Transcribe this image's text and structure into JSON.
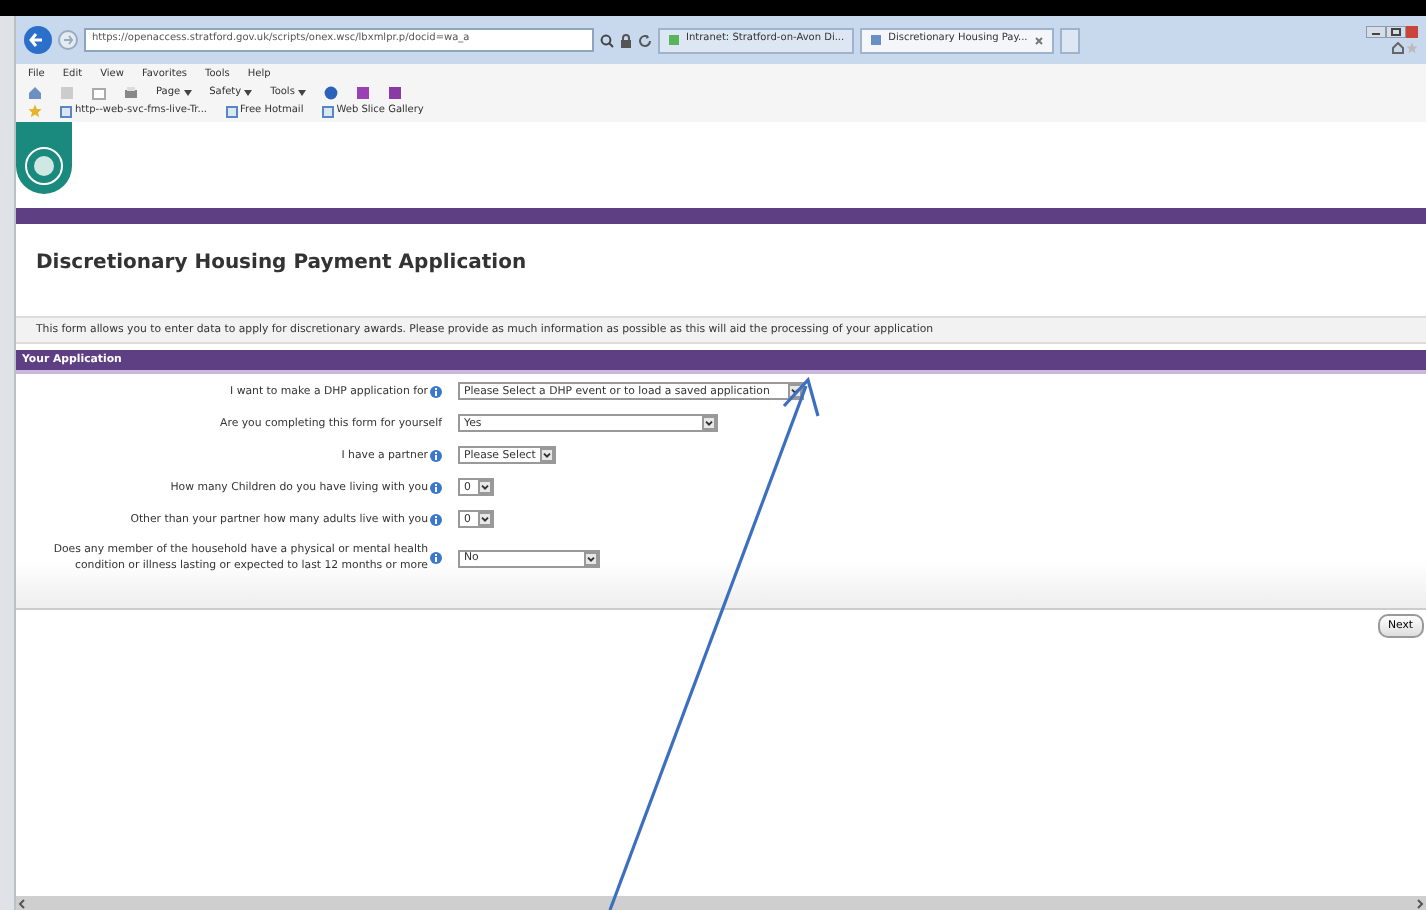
{
  "browser": {
    "address": "https://openaccess.stratford.gov.uk/scripts/onex.wsc/lbxmlpr.p/docid=wa_a",
    "tabs": [
      {
        "label": "Intranet: Stratford-on-Avon Di...",
        "selected": false
      },
      {
        "label": "Discretionary Housing Pay...",
        "selected": true
      }
    ],
    "menu": [
      "File",
      "Edit",
      "View",
      "Favorites",
      "Tools",
      "Help"
    ],
    "commands": [
      "Page",
      "Safety",
      "Tools"
    ],
    "favorites": [
      "http--web-svc-fms-live-Tr...",
      "Free Hotmail",
      "Web Slice Gallery"
    ]
  },
  "page": {
    "title": "Discretionary Housing Payment Application",
    "intro": "This form allows you to enter data to apply for discretionary awards. Please provide as much information as possible as this will aid the processing of your application",
    "section": "Your Application",
    "fields": [
      {
        "label": "I want to make a DHP application for",
        "help": true,
        "value": "Please Select a DHP event or to load a saved application"
      },
      {
        "label": "Are you completing this form for yourself",
        "help": false,
        "value": "Yes"
      },
      {
        "label": "I have a partner",
        "help": true,
        "value": "Please Select"
      },
      {
        "label": "How many Children do you have living with you",
        "help": true,
        "value": "0"
      },
      {
        "label": "Other than your partner how many adults live with you",
        "help": true,
        "value": "0"
      },
      {
        "label": "Does any member of the household have a physical or mental health condition or illness lasting or expected to last 12 months or more",
        "help": true,
        "value": "No"
      }
    ],
    "next_button": "Next"
  }
}
